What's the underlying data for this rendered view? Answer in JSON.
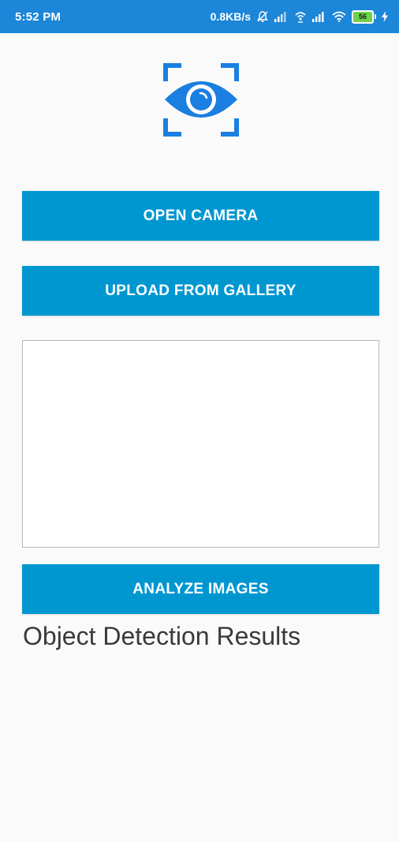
{
  "status_bar": {
    "time": "5:52 PM",
    "net_speed": "0.8KB/s",
    "battery_level": "56",
    "icons": [
      "muted-bell-icon",
      "signal-icon",
      "wifi-hotspot-icon",
      "signal-icon",
      "wifi-icon",
      "battery-icon",
      "charging-icon"
    ],
    "background_color": "#1c86d8"
  },
  "logo": {
    "icon": "eye-scan-icon",
    "color": "#1a7fe0"
  },
  "buttons": {
    "open_camera": "OPEN CAMERA",
    "upload_gallery": "UPLOAD FROM GALLERY",
    "analyze_images": "ANALYZE IMAGES",
    "color": "#0097d1"
  },
  "results": {
    "title": "Object Detection Results"
  }
}
